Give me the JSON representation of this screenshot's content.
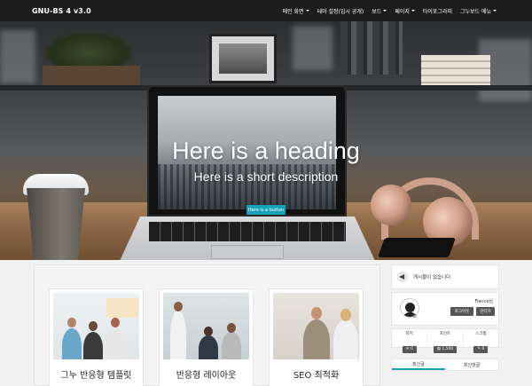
{
  "navbar": {
    "brand": "GNU-BS 4 v3.0",
    "items": [
      {
        "label": "메인 화면",
        "dropdown": true
      },
      {
        "label": "테마 설정(임시 공개)",
        "dropdown": false
      },
      {
        "label": "보드",
        "dropdown": true
      },
      {
        "label": "페이지",
        "dropdown": true
      },
      {
        "label": "타이포그라피",
        "dropdown": false
      },
      {
        "label": "그누보드 메뉴",
        "dropdown": true
      }
    ]
  },
  "hero": {
    "heading": "Here is a heading",
    "description": "Here is a short description",
    "button_label": "Here is a button",
    "button_color": "#17a2b8"
  },
  "cards": [
    {
      "title": "그누 반응형 템플릿"
    },
    {
      "title": "반응형 레이아웃"
    },
    {
      "title": "SEO 최적화"
    }
  ],
  "sidebar": {
    "notice_icon": "megaphone-icon",
    "notice_text": "게시물이 없습니다.",
    "profile": {
      "nickname": "Fiance님",
      "logout_label": "로그아웃",
      "admin_label": "관리자"
    },
    "stats": [
      {
        "label": "쪽지",
        "value": "0"
      },
      {
        "label": "포인트",
        "value": "1,500"
      },
      {
        "label": "스크랩",
        "value": "0"
      }
    ],
    "tabs": [
      {
        "label": "최신글",
        "active": true
      },
      {
        "label": "최신댓글",
        "active": false
      }
    ]
  }
}
